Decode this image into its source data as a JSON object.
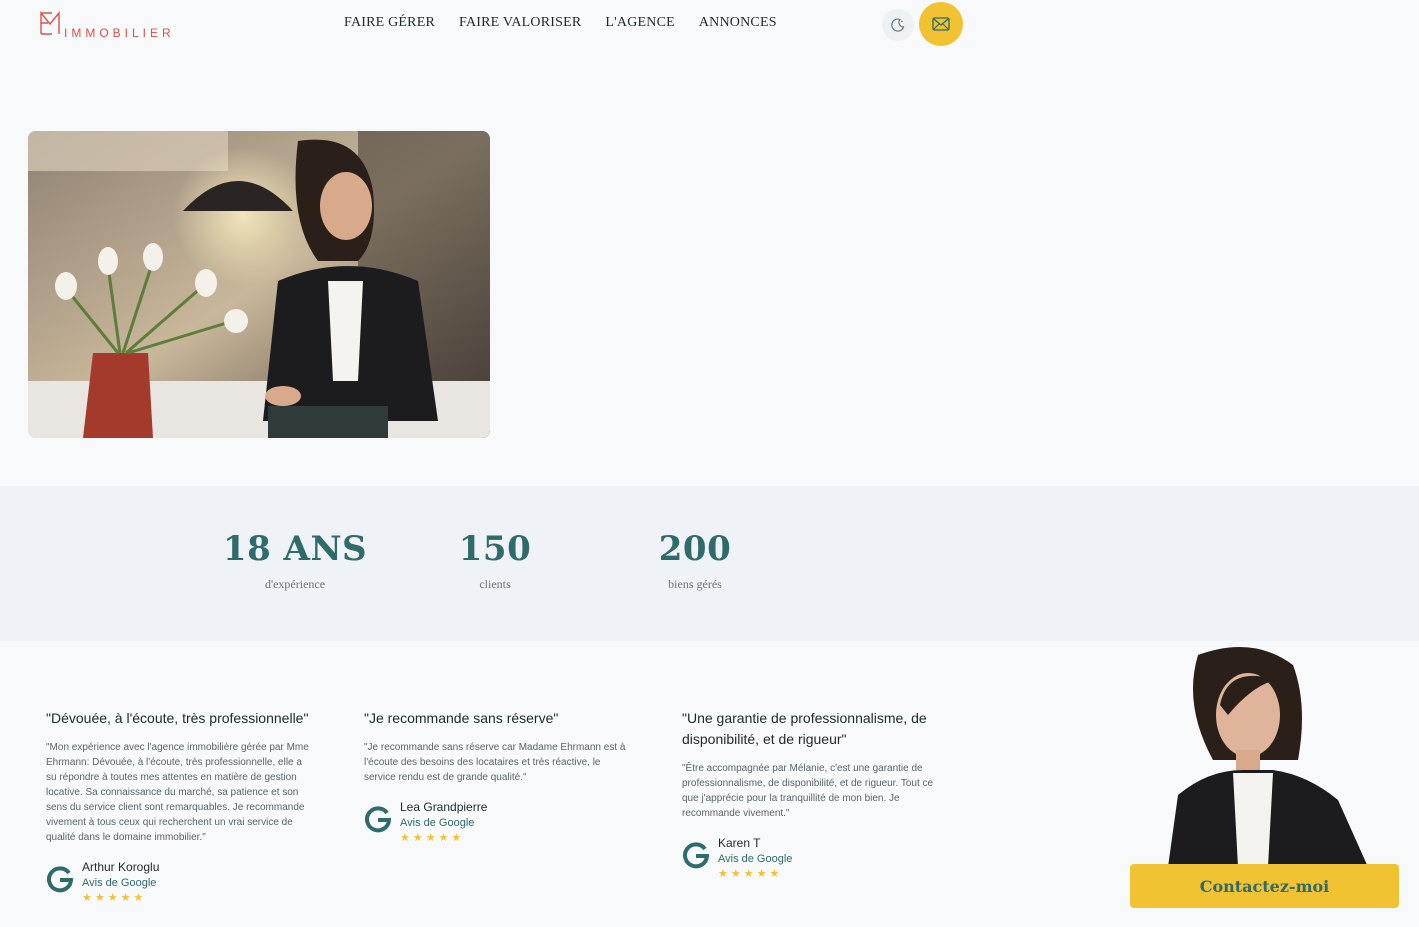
{
  "header": {
    "logo_text": "IMMOBILIER",
    "nav": [
      {
        "label": "FAIRE GÉRER"
      },
      {
        "label": "FAIRE VALORISER"
      },
      {
        "label": "L'AGENCE"
      },
      {
        "label": "ANNONCES"
      }
    ],
    "theme_icon": "moon-icon",
    "mail_icon": "envelope-icon"
  },
  "stats": [
    {
      "value": "18 ANS",
      "label": "d'expérience"
    },
    {
      "value": "150",
      "label": "clients"
    },
    {
      "value": "200",
      "label": "biens gérés"
    }
  ],
  "reviews": [
    {
      "title": "\"Dévouée, à l'écoute, très professionnelle\"",
      "body": "\"Mon expérience avec l'agence immobilière gérée par Mme Ehrmann: Dévouée, à l'écoute, très professionnelle, elle a su répondre à toutes mes attentes en matière de gestion locative. Sa connaissance du marché, sa patience et son sens du service client sont remarquables. Je recommande vivement à tous ceux qui recherchent un vrai service de qualité dans le domaine immobilier.\"",
      "name": "Arthur Koroglu",
      "source": "Avis de Google",
      "stars": "★★★★★"
    },
    {
      "title": "\"Je recommande sans réserve\"",
      "body": "\"Je recommande sans réserve car Madame Ehrmann est à l'écoute des besoins des locataires et très réactive, le service rendu est de grande qualité.\"",
      "name": "Lea Grandpierre",
      "source": "Avis de Google",
      "stars": "★★★★★"
    },
    {
      "title": "\"Une garantie de professionnalisme, de disponibilité, et de rigueur\"",
      "body": "\"Être accompagnée par Mélanie, c'est une garantie de professionnalisme, de disponibilité, et de rigueur. Tout ce que j'apprécie pour la tranquillité de mon bien. Je recommande vivement.\"",
      "name": "Karen T",
      "source": "Avis de Google",
      "stars": "★★★★★"
    }
  ],
  "cta": {
    "label": "Contactez-moi"
  },
  "colors": {
    "accent": "#f1c232",
    "teal": "#2f6b6b",
    "brand_red": "#d9534a"
  }
}
